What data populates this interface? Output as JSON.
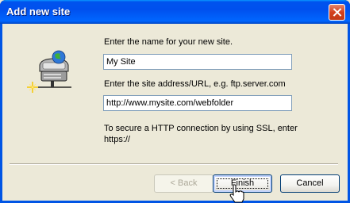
{
  "window": {
    "title": "Add new site"
  },
  "form": {
    "name_prompt": "Enter the name for your new site.",
    "name_value": "My Site",
    "url_prompt": "Enter the site address/URL, e.g. ftp.server.com",
    "url_value": "http://www.mysite.com/webfolder",
    "ssl_hint_line1": "To secure a HTTP connection by using SSL, enter",
    "ssl_hint_line2": "https://"
  },
  "buttons": {
    "back_label": "< Back",
    "finish_label": "Finish",
    "cancel_label": "Cancel"
  },
  "icons": {
    "wizard": "network-server-wizard-icon",
    "close": "close-icon",
    "cursor": "hand-pointer-cursor"
  },
  "colors": {
    "title_bar": "#0054e3",
    "close_button": "#d4401d",
    "dialog_background": "#ece9d8",
    "field_border": "#7f9db9"
  }
}
